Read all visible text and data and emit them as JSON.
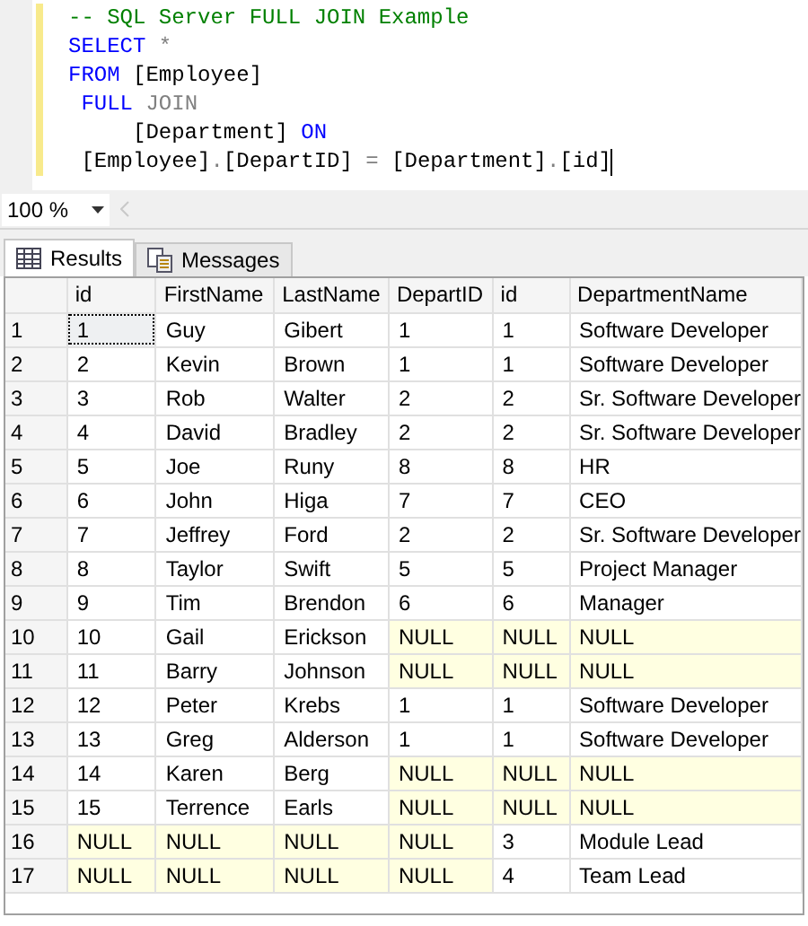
{
  "editor": {
    "lines": [
      [
        {
          "kind": "comment",
          "text": "-- SQL Server FULL JOIN Example"
        }
      ],
      [
        {
          "kind": "keyword",
          "text": "SELECT"
        },
        {
          "kind": "operator",
          "text": " *"
        }
      ],
      [
        {
          "kind": "keyword",
          "text": "FROM"
        },
        {
          "kind": "plain",
          "text": " [Employee]"
        }
      ],
      [
        {
          "kind": "keyword",
          "text": " FULL"
        },
        {
          "kind": "operator",
          "text": " JOIN"
        }
      ],
      [
        {
          "kind": "plain",
          "text": "     [Department] "
        },
        {
          "kind": "keyword",
          "text": "ON"
        }
      ],
      [
        {
          "kind": "plain",
          "text": " [Employee]"
        },
        {
          "kind": "operator",
          "text": "."
        },
        {
          "kind": "plain",
          "text": "[DepartID] "
        },
        {
          "kind": "operator",
          "text": "="
        },
        {
          "kind": "plain",
          "text": " [Department]"
        },
        {
          "kind": "operator",
          "text": "."
        },
        {
          "kind": "plain",
          "text": "[id]"
        }
      ]
    ]
  },
  "zoom": {
    "value": "100 %"
  },
  "tabs": [
    {
      "label": "Results",
      "selected": true
    },
    {
      "label": "Messages",
      "selected": false
    }
  ],
  "table": {
    "columns": [
      "id",
      "FirstName",
      "LastName",
      "DepartID",
      "id",
      "DepartmentName"
    ],
    "rows": [
      {
        "number": "1",
        "cells": [
          "1",
          "Guy",
          "Gibert",
          "1",
          "1",
          "Software Developer"
        ],
        "nulls": [
          false,
          false,
          false,
          false,
          false,
          false
        ],
        "selected": [
          true,
          false,
          false,
          false,
          false,
          false
        ]
      },
      {
        "number": "2",
        "cells": [
          "2",
          "Kevin",
          "Brown",
          "1",
          "1",
          "Software Developer"
        ],
        "nulls": [
          false,
          false,
          false,
          false,
          false,
          false
        ],
        "selected": [
          false,
          false,
          false,
          false,
          false,
          false
        ]
      },
      {
        "number": "3",
        "cells": [
          "3",
          "Rob",
          "Walter",
          "2",
          "2",
          "Sr. Software Developer"
        ],
        "nulls": [
          false,
          false,
          false,
          false,
          false,
          false
        ],
        "selected": [
          false,
          false,
          false,
          false,
          false,
          false
        ]
      },
      {
        "number": "4",
        "cells": [
          "4",
          "David",
          "Bradley",
          "2",
          "2",
          "Sr. Software Developer"
        ],
        "nulls": [
          false,
          false,
          false,
          false,
          false,
          false
        ],
        "selected": [
          false,
          false,
          false,
          false,
          false,
          false
        ]
      },
      {
        "number": "5",
        "cells": [
          "5",
          "Joe",
          "Runy",
          "8",
          "8",
          "HR"
        ],
        "nulls": [
          false,
          false,
          false,
          false,
          false,
          false
        ],
        "selected": [
          false,
          false,
          false,
          false,
          false,
          false
        ]
      },
      {
        "number": "6",
        "cells": [
          "6",
          "John",
          "Higa",
          "7",
          "7",
          "CEO"
        ],
        "nulls": [
          false,
          false,
          false,
          false,
          false,
          false
        ],
        "selected": [
          false,
          false,
          false,
          false,
          false,
          false
        ]
      },
      {
        "number": "7",
        "cells": [
          "7",
          "Jeffrey",
          "Ford",
          "2",
          "2",
          "Sr. Software Developer"
        ],
        "nulls": [
          false,
          false,
          false,
          false,
          false,
          false
        ],
        "selected": [
          false,
          false,
          false,
          false,
          false,
          false
        ]
      },
      {
        "number": "8",
        "cells": [
          "8",
          "Taylor",
          "Swift",
          "5",
          "5",
          "Project Manager"
        ],
        "nulls": [
          false,
          false,
          false,
          false,
          false,
          false
        ],
        "selected": [
          false,
          false,
          false,
          false,
          false,
          false
        ]
      },
      {
        "number": "9",
        "cells": [
          "9",
          "Tim",
          "Brendon",
          "6",
          "6",
          "Manager"
        ],
        "nulls": [
          false,
          false,
          false,
          false,
          false,
          false
        ],
        "selected": [
          false,
          false,
          false,
          false,
          false,
          false
        ]
      },
      {
        "number": "10",
        "cells": [
          "10",
          "Gail",
          "Erickson",
          "NULL",
          "NULL",
          "NULL"
        ],
        "nulls": [
          false,
          false,
          false,
          true,
          true,
          true
        ],
        "selected": [
          false,
          false,
          false,
          false,
          false,
          false
        ]
      },
      {
        "number": "11",
        "cells": [
          "11",
          "Barry",
          "Johnson",
          "NULL",
          "NULL",
          "NULL"
        ],
        "nulls": [
          false,
          false,
          false,
          true,
          true,
          true
        ],
        "selected": [
          false,
          false,
          false,
          false,
          false,
          false
        ]
      },
      {
        "number": "12",
        "cells": [
          "12",
          "Peter",
          "Krebs",
          "1",
          "1",
          "Software Developer"
        ],
        "nulls": [
          false,
          false,
          false,
          false,
          false,
          false
        ],
        "selected": [
          false,
          false,
          false,
          false,
          false,
          false
        ]
      },
      {
        "number": "13",
        "cells": [
          "13",
          "Greg",
          "Alderson",
          "1",
          "1",
          "Software Developer"
        ],
        "nulls": [
          false,
          false,
          false,
          false,
          false,
          false
        ],
        "selected": [
          false,
          false,
          false,
          false,
          false,
          false
        ]
      },
      {
        "number": "14",
        "cells": [
          "14",
          "Karen",
          "Berg",
          "NULL",
          "NULL",
          "NULL"
        ],
        "nulls": [
          false,
          false,
          false,
          true,
          true,
          true
        ],
        "selected": [
          false,
          false,
          false,
          false,
          false,
          false
        ]
      },
      {
        "number": "15",
        "cells": [
          "15",
          "Terrence",
          "Earls",
          "NULL",
          "NULL",
          "NULL"
        ],
        "nulls": [
          false,
          false,
          false,
          true,
          true,
          true
        ],
        "selected": [
          false,
          false,
          false,
          false,
          false,
          false
        ]
      },
      {
        "number": "16",
        "cells": [
          "NULL",
          "NULL",
          "NULL",
          "NULL",
          "3",
          "Module Lead"
        ],
        "nulls": [
          true,
          true,
          true,
          true,
          false,
          false
        ],
        "selected": [
          false,
          false,
          false,
          false,
          false,
          false
        ]
      },
      {
        "number": "17",
        "cells": [
          "NULL",
          "NULL",
          "NULL",
          "NULL",
          "4",
          "Team Lead"
        ],
        "nulls": [
          true,
          true,
          true,
          true,
          false,
          false
        ],
        "selected": [
          false,
          false,
          false,
          false,
          false,
          false
        ]
      }
    ]
  }
}
